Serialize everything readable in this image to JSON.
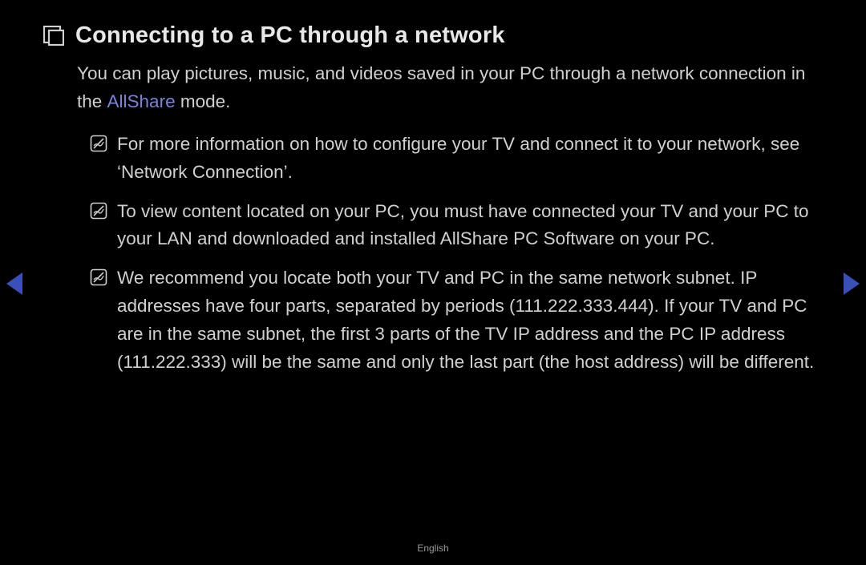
{
  "title": "Connecting to a PC through a network",
  "intro_pre": "You can play pictures, music, and videos saved in your PC through a network connection in the ",
  "intro_highlight": "AllShare",
  "intro_post": " mode.",
  "notes": [
    "For more information on how to configure your TV and connect it to your network, see ‘Network Connection’.",
    "To view content located on your PC, you must have connected your TV and your PC to your LAN and downloaded and installed AllShare PC Software on your PC.",
    "We recommend you locate both your TV and PC in the same network subnet. IP addresses have four parts, separated by periods (111.222.333.444). If your TV and PC are in the same subnet, the first 3 parts of the TV IP address and the PC IP address (111.222.333) will be the same and only the last part (the host address) will be different."
  ],
  "footer": "English"
}
